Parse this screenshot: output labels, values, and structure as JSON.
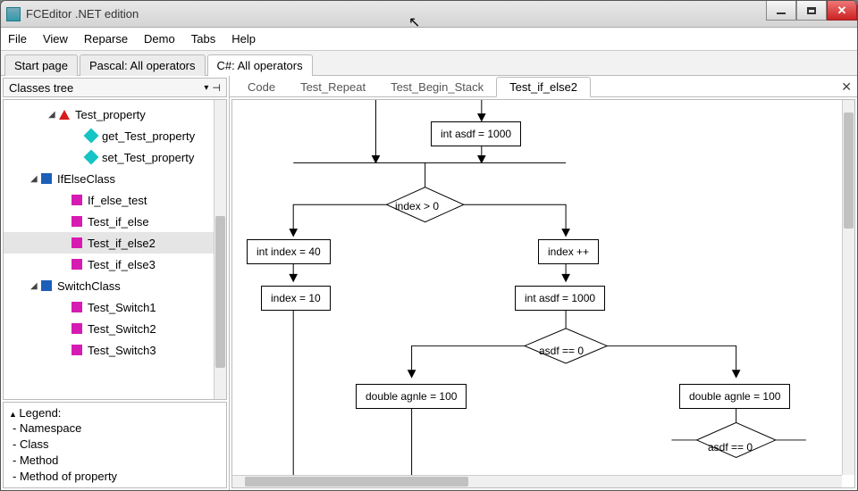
{
  "title": "FCEditor .NET edition",
  "menu": [
    "File",
    "View",
    "Reparse",
    "Demo",
    "Tabs",
    "Help"
  ],
  "fileTabs": [
    {
      "label": "Start page",
      "active": false
    },
    {
      "label": "Pascal: All operators",
      "active": false
    },
    {
      "label": "C#: All operators",
      "active": true
    }
  ],
  "sidebar": {
    "title": "Classes tree",
    "items": [
      {
        "indent": 50,
        "exp": "◢",
        "ico": "red",
        "label": "Test_property"
      },
      {
        "indent": 80,
        "exp": "",
        "ico": "prop",
        "label": "get_Test_property"
      },
      {
        "indent": 80,
        "exp": "",
        "ico": "prop",
        "label": "set_Test_property"
      },
      {
        "indent": 30,
        "exp": "◢",
        "ico": "cls",
        "label": "IfElseClass"
      },
      {
        "indent": 64,
        "exp": "",
        "ico": "method",
        "label": "If_else_test"
      },
      {
        "indent": 64,
        "exp": "",
        "ico": "method",
        "label": "Test_if_else"
      },
      {
        "indent": 64,
        "exp": "",
        "ico": "method",
        "label": "Test_if_else2",
        "selected": true
      },
      {
        "indent": 64,
        "exp": "",
        "ico": "method",
        "label": "Test_if_else3"
      },
      {
        "indent": 30,
        "exp": "◢",
        "ico": "cls",
        "label": "SwitchClass"
      },
      {
        "indent": 64,
        "exp": "",
        "ico": "method",
        "label": "Test_Switch1"
      },
      {
        "indent": 64,
        "exp": "",
        "ico": "method",
        "label": "Test_Switch2"
      },
      {
        "indent": 64,
        "exp": "",
        "ico": "method",
        "label": "Test_Switch3"
      }
    ]
  },
  "legend": {
    "title": "Legend:",
    "rows": [
      {
        "ico": "ns",
        "label": "- Namespace"
      },
      {
        "ico": "cls",
        "label": "- Class"
      },
      {
        "ico": "method",
        "label": "- Method"
      },
      {
        "ico": "prop",
        "label": "- Method of property"
      }
    ]
  },
  "innerTabs": [
    {
      "label": "Code",
      "active": false
    },
    {
      "label": "Test_Repeat",
      "active": false
    },
    {
      "label": "Test_Begin_Stack",
      "active": false
    },
    {
      "label": "Test_if_else2",
      "active": true
    }
  ],
  "flow": {
    "b1": "int  asdf = 1000",
    "d1": "index > 0",
    "bL1": "int  index = 40",
    "bL2": "index  = 10",
    "bR1": "index ++",
    "bR2": "int  asdf  = 1000",
    "d2": "asdf == 0",
    "bC": "double  agnle = 100",
    "bRR": "double  agnle = 100",
    "d3": "asdf == 0"
  }
}
